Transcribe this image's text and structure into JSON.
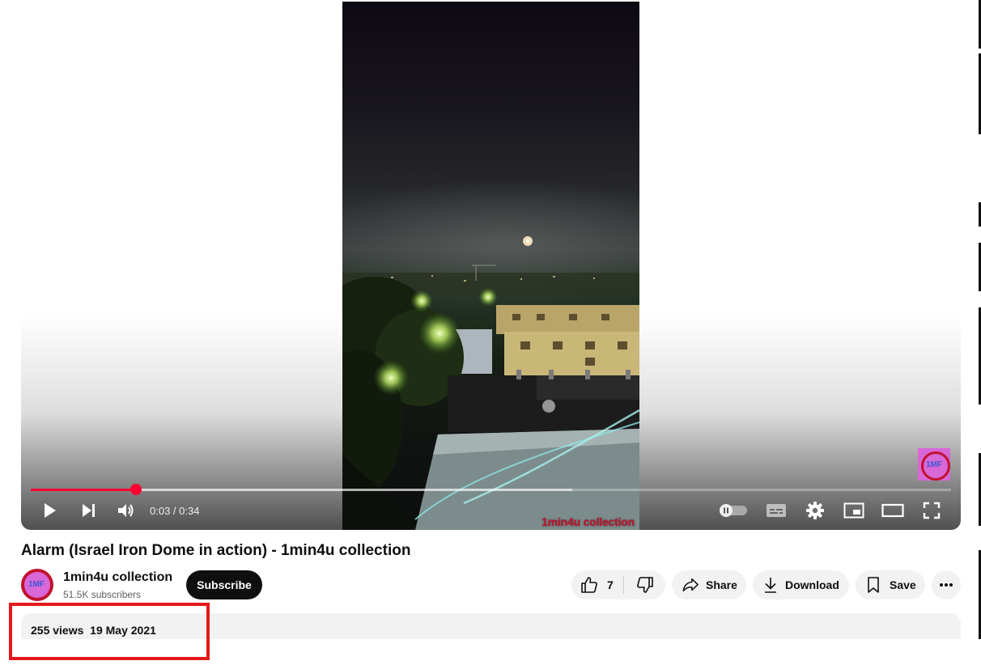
{
  "player": {
    "current_time": "0:03",
    "duration": "0:34",
    "time_display": "0:03 / 0:34",
    "progress_fraction": 0.114,
    "buffered_fraction": 0.588,
    "watermark": "1min4u collection",
    "branding_label": "1MF",
    "accent_color": "#ff0033",
    "icons": [
      "play-icon",
      "next-icon",
      "volume-icon",
      "autoplay-toggle-icon",
      "subtitles-icon",
      "settings-icon",
      "miniplayer-icon",
      "theater-mode-icon",
      "fullscreen-icon"
    ]
  },
  "video": {
    "title": "Alarm (Israel Iron Dome in action) - 1min4u collection"
  },
  "channel": {
    "name": "1min4u collection",
    "subscribers": "51.5K subscribers",
    "avatar_label": "1MF",
    "subscribe_label": "Subscribe"
  },
  "actions": {
    "like_count": "7",
    "share_label": "Share",
    "download_label": "Download",
    "save_label": "Save"
  },
  "description": {
    "meta": "255 views  19 May 2021"
  },
  "highlight_color": "#e31a1a"
}
